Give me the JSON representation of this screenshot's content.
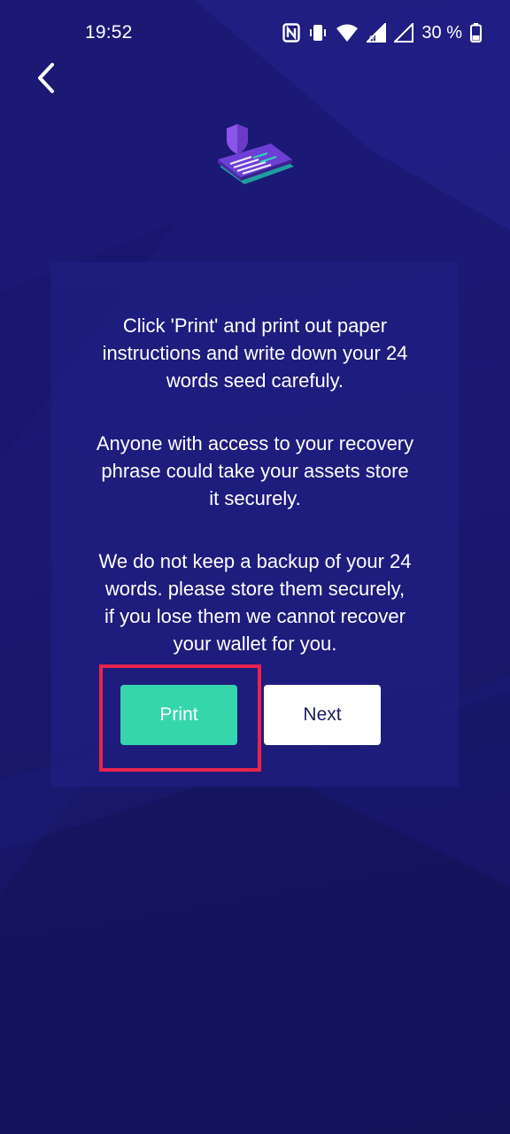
{
  "status_bar": {
    "time": "19:52",
    "battery": "30 %",
    "icons": [
      "nfc-icon",
      "vibrate-icon",
      "wifi-icon",
      "signal-r-icon",
      "signal-icon",
      "battery-icon"
    ]
  },
  "header": {
    "back_icon": "chevron-left-icon"
  },
  "hero": {
    "icon": "shield-seed-card-icon"
  },
  "card": {
    "paragraph_1": "Click 'Print' and print out paper\ninstructions and write down your 24\nwords seed carefuly.",
    "paragraph_2": "Anyone with access to your recovery\nphrase could take your assets store\nit securely.",
    "paragraph_3": "We do not keep a backup of your 24\nwords. please store them securely,\nif you lose them we cannot recover\nyour wallet for you."
  },
  "actions": {
    "print_label": "Print",
    "next_label": "Next"
  },
  "colors": {
    "background": "#1a1870",
    "card": "#201e82",
    "print_button": "#36d6ad",
    "next_button": "#ffffff",
    "highlight": "#e8244c"
  }
}
